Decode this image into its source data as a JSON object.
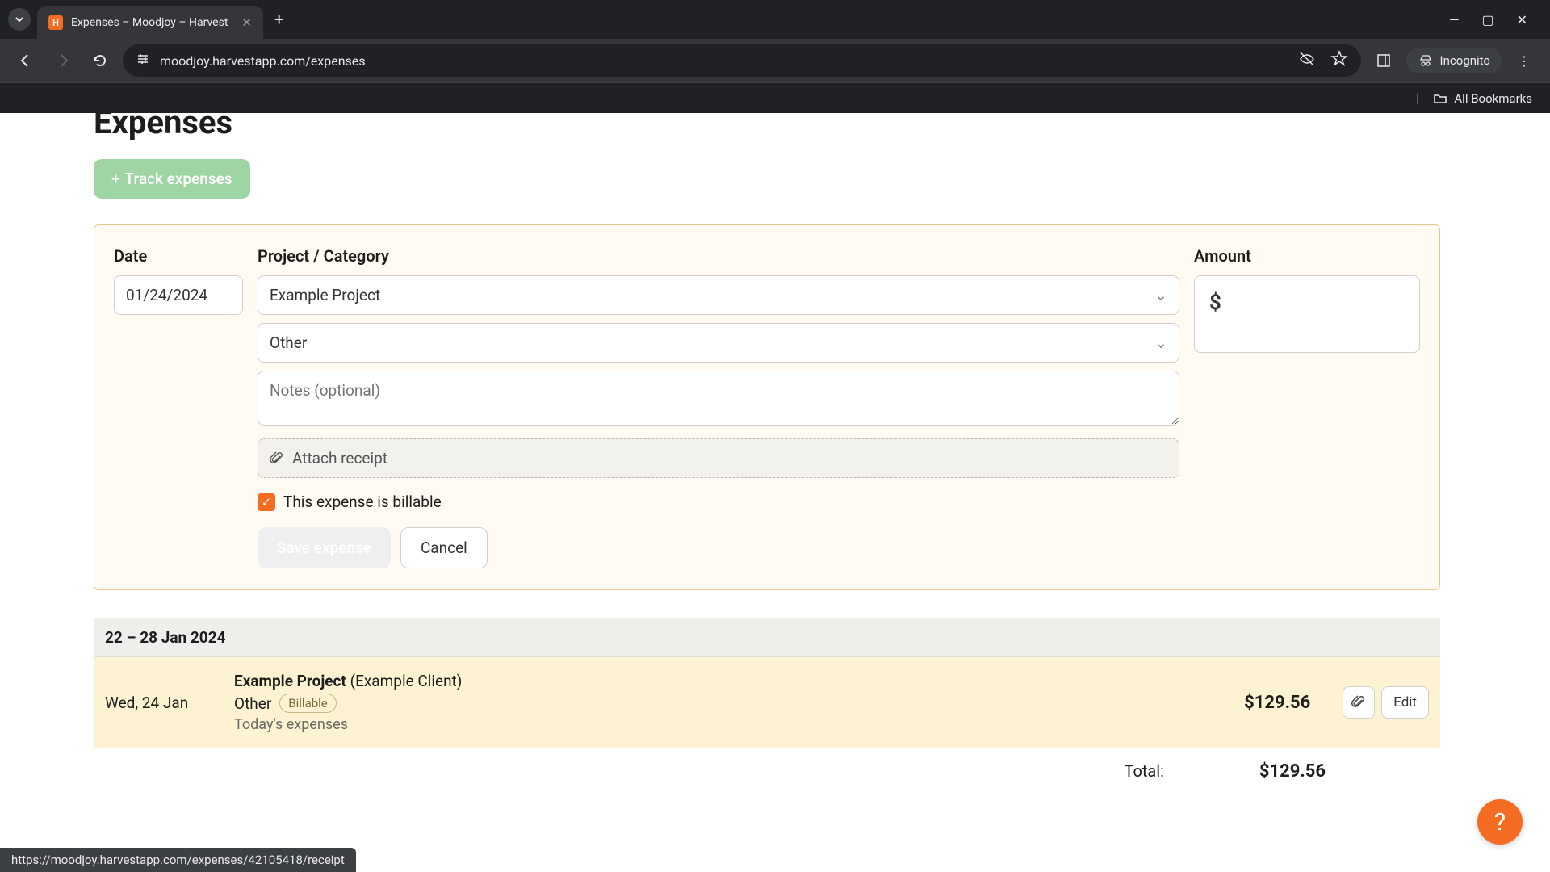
{
  "browser": {
    "tab_title": "Expenses – Moodjoy – Harvest",
    "favicon_letter": "H",
    "url": "moodjoy.harvestapp.com/expenses",
    "incognito_label": "Incognito",
    "bookmarks_label": "All Bookmarks"
  },
  "page": {
    "title": "Expenses",
    "track_button": "Track expenses"
  },
  "form": {
    "date_label": "Date",
    "date_value": "01/24/2024",
    "project_label": "Project / Category",
    "project_value": "Example Project",
    "category_value": "Other",
    "notes_placeholder": "Notes (optional)",
    "attach_label": "Attach receipt",
    "billable_label": "This expense is billable",
    "amount_label": "Amount",
    "amount_prefix": "$",
    "save_label": "Save expense",
    "cancel_label": "Cancel"
  },
  "week": {
    "range": "22 – 28 Jan 2024",
    "rows": [
      {
        "date": "Wed, 24 Jan",
        "project": "Example Project",
        "client": "(Example Client)",
        "category": "Other",
        "badge": "Billable",
        "note": "Today's expenses",
        "amount": "$129.56",
        "edit_label": "Edit"
      }
    ],
    "total_label": "Total:",
    "total_value": "$129.56"
  },
  "status_url": "https://moodjoy.harvestapp.com/expenses/42105418/receipt"
}
